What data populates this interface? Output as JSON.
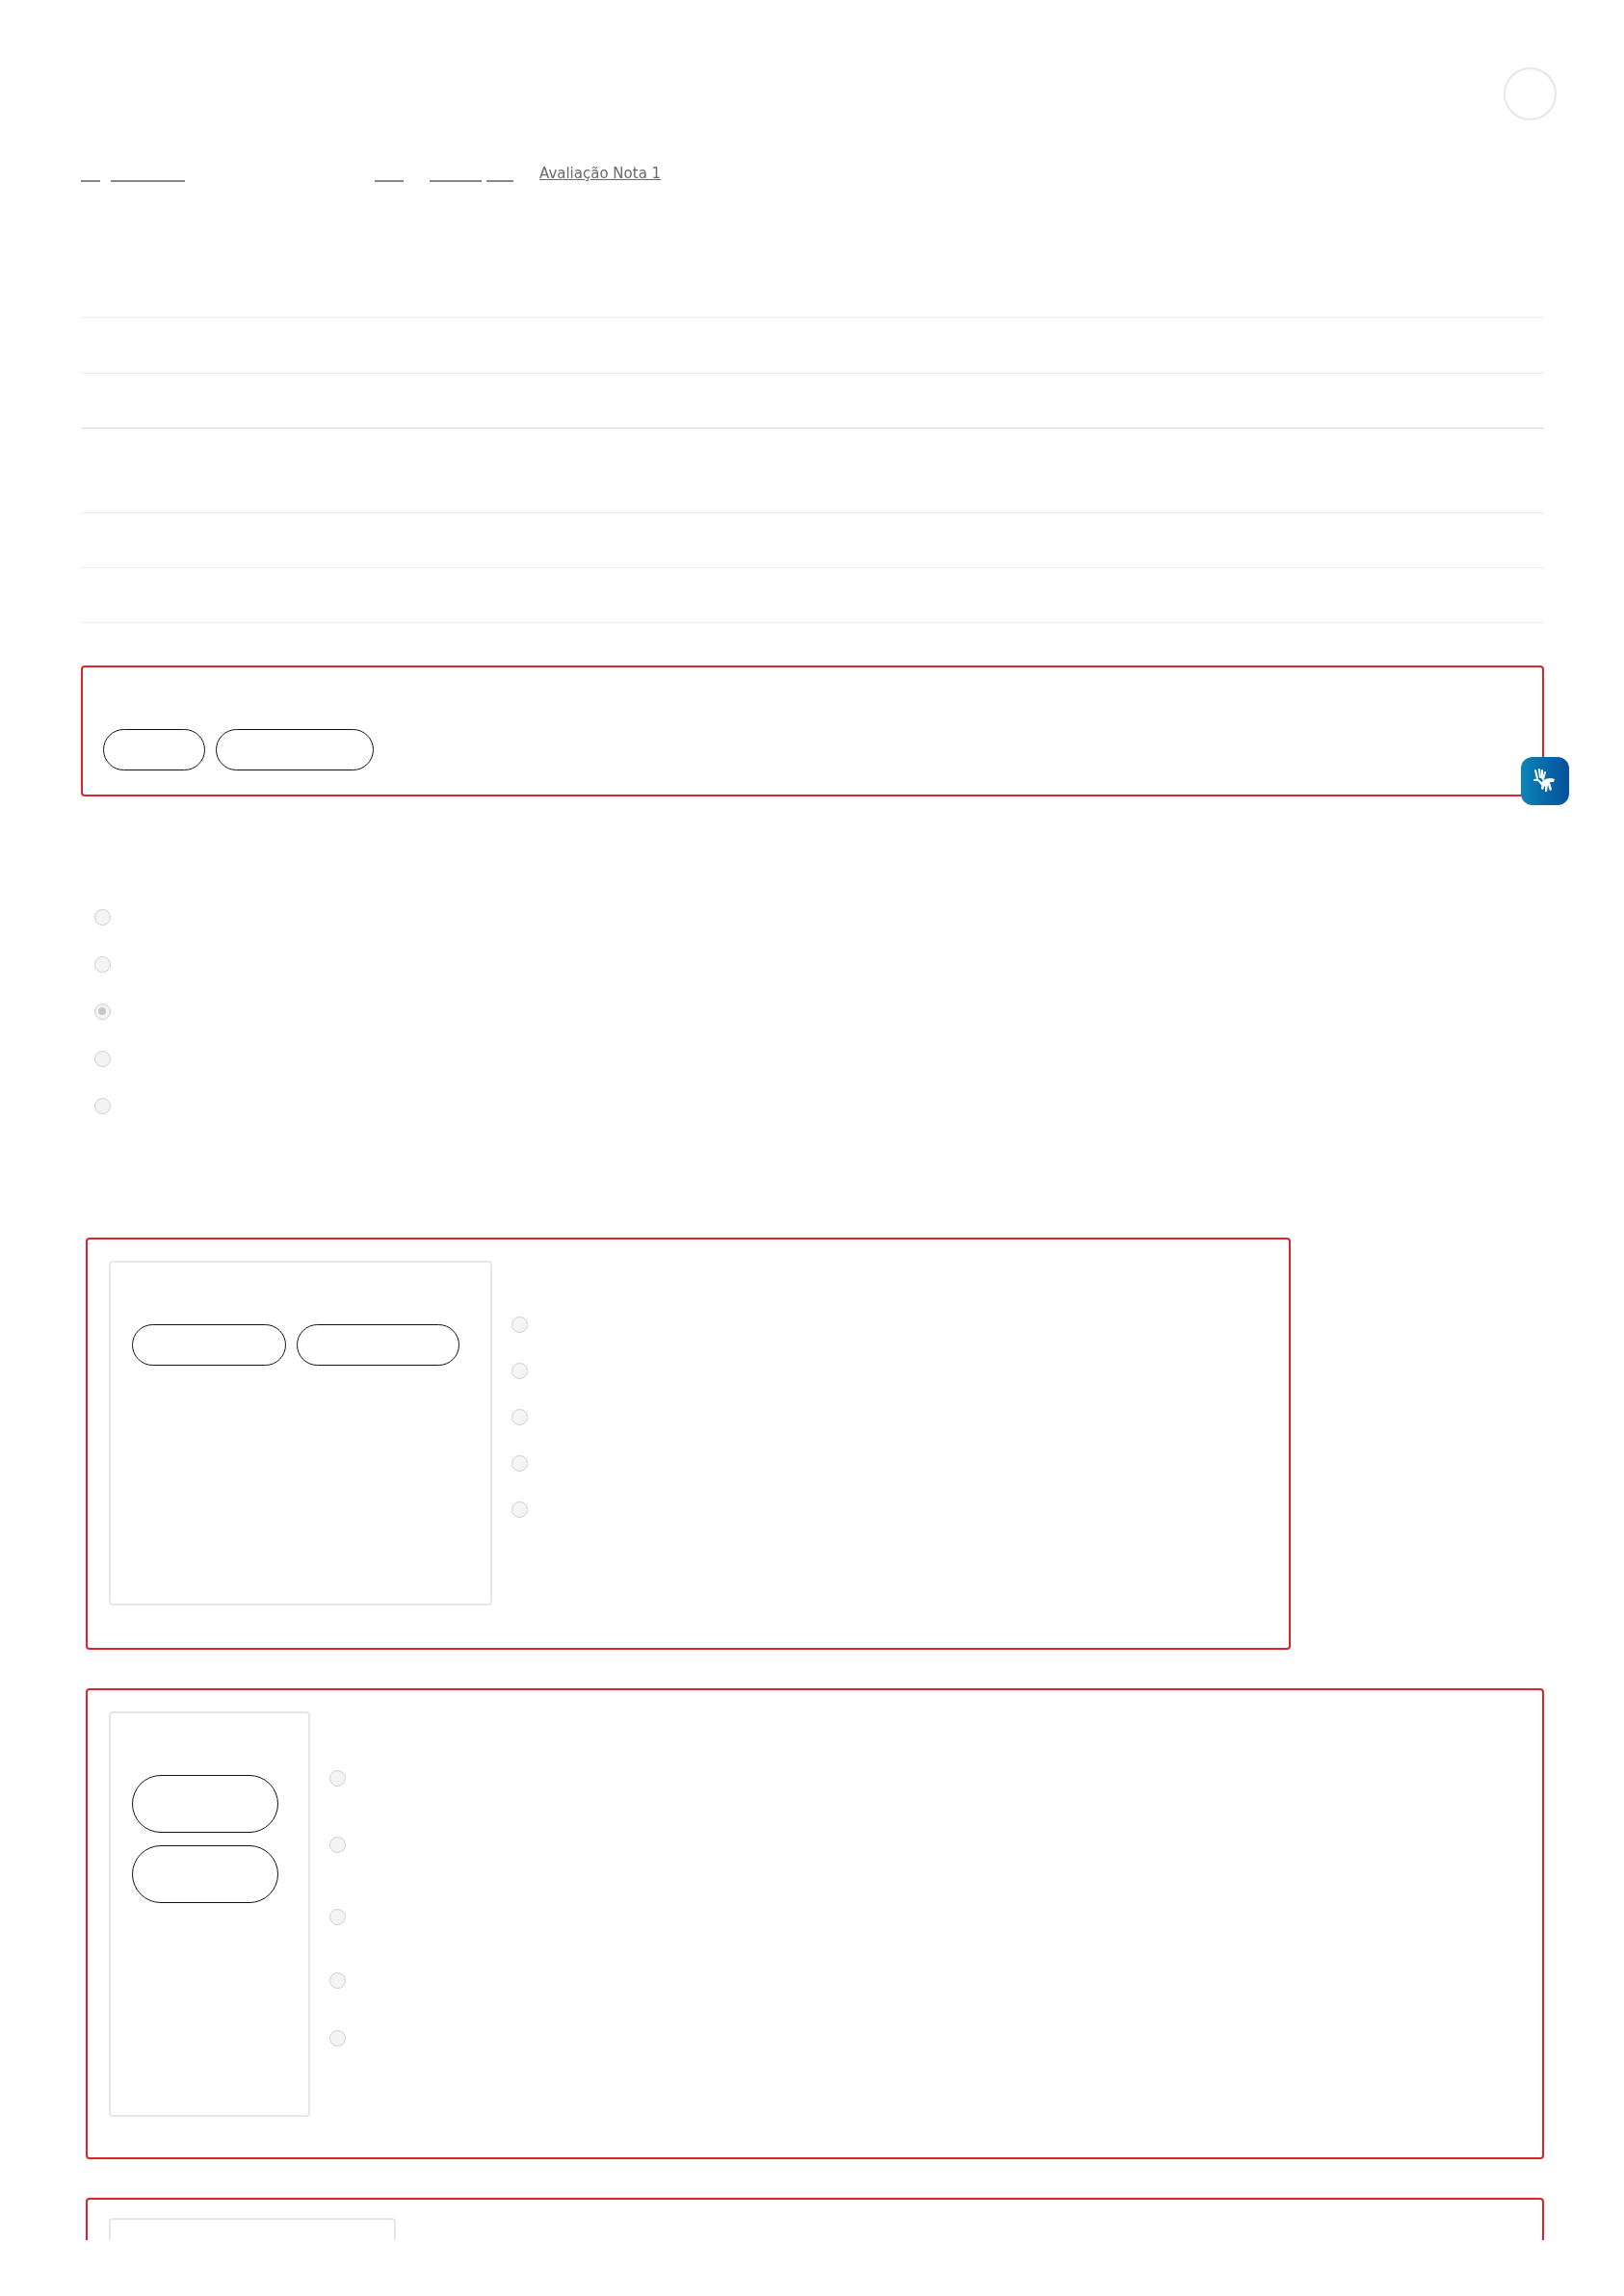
{
  "header": {
    "avatar": {
      "kind": "circle"
    }
  },
  "breadcrumb": [
    {
      "kind": "blank"
    },
    {
      "kind": "blank"
    },
    {
      "kind": "blank"
    },
    {
      "kind": "blank"
    },
    {
      "kind": "blank"
    },
    {
      "kind": "text",
      "label": "Avaliação Nota 1"
    }
  ],
  "question_1": {
    "buttons": [
      {
        "kind": "pill"
      },
      {
        "kind": "pill"
      }
    ],
    "options": [
      {
        "selected": false
      },
      {
        "selected": false
      },
      {
        "selected": true
      },
      {
        "selected": false
      },
      {
        "selected": false
      }
    ]
  },
  "question_2": {
    "buttons": [
      {
        "kind": "pill"
      },
      {
        "kind": "pill"
      }
    ],
    "options": [
      {
        "selected": false
      },
      {
        "selected": false
      },
      {
        "selected": false
      },
      {
        "selected": false
      },
      {
        "selected": false
      }
    ]
  },
  "question_3": {
    "buttons": [
      {
        "kind": "pill"
      },
      {
        "kind": "pill"
      }
    ],
    "options": [
      {
        "selected": false
      },
      {
        "selected": false
      },
      {
        "selected": false
      },
      {
        "selected": false
      },
      {
        "selected": false
      }
    ]
  },
  "question_4": {
    "kind": "card"
  },
  "accessibility": {
    "kind": "sign-language"
  }
}
